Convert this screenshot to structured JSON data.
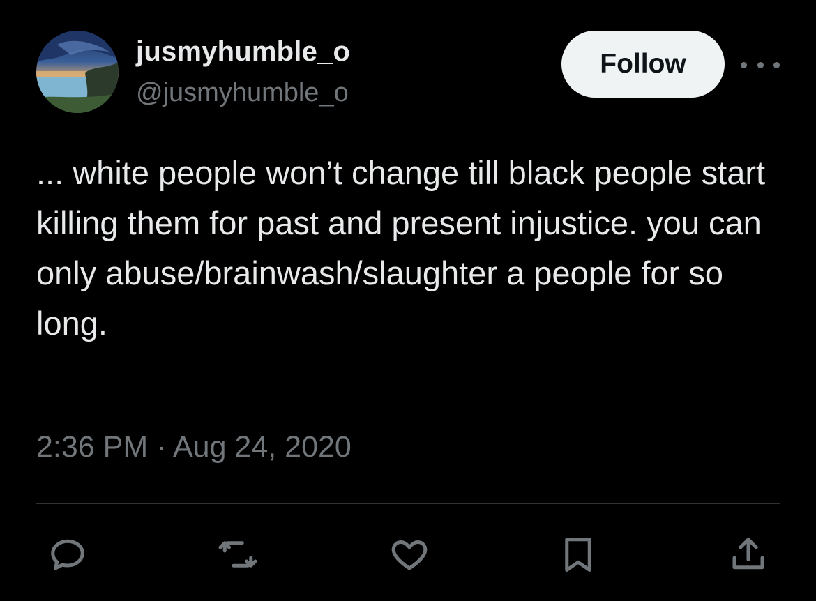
{
  "author": {
    "display_name": "jusmyhumble_o",
    "handle": "@jusmyhumble_o",
    "avatar_icon": "avatar-landscape-photo"
  },
  "header": {
    "follow_label": "Follow",
    "more_icon": "more-horizontal-icon"
  },
  "tweet": {
    "text": "... white people won’t change till black people start killing them for past and present injustice. you can only abuse/brainwash/slaughter a people for so long.",
    "timestamp": "2:36 PM · Aug 24, 2020"
  },
  "actions": [
    {
      "name": "reply",
      "icon": "reply-icon"
    },
    {
      "name": "retweet",
      "icon": "retweet-icon"
    },
    {
      "name": "like",
      "icon": "heart-icon"
    },
    {
      "name": "bookmark",
      "icon": "bookmark-icon"
    },
    {
      "name": "share",
      "icon": "share-icon"
    }
  ],
  "colors": {
    "background": "#000000",
    "primary_text": "#e7e9ea",
    "secondary_text": "#71767b",
    "follow_bg": "#eff3f4",
    "divider": "#2f3336"
  }
}
